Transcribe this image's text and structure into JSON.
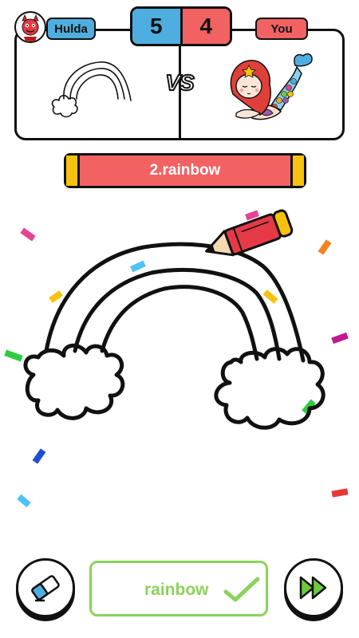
{
  "players": {
    "opponent_name": "Hulda",
    "player_name": "You"
  },
  "score": {
    "opponent": "5",
    "player": "4"
  },
  "versus_label": "VS",
  "word_banner": "2.rainbow",
  "answer": {
    "text": "rainbow",
    "status": "correct"
  },
  "colors": {
    "opponent_blue": "#4faee0",
    "player_red": "#f26262",
    "banner_gold": "#f6c20f",
    "answer_green": "#8cd25a"
  },
  "icons": {
    "eraser": "eraser-icon",
    "skip": "fast-forward-icon",
    "confirm": "checkmark-icon",
    "pencil": "pencil-icon"
  }
}
